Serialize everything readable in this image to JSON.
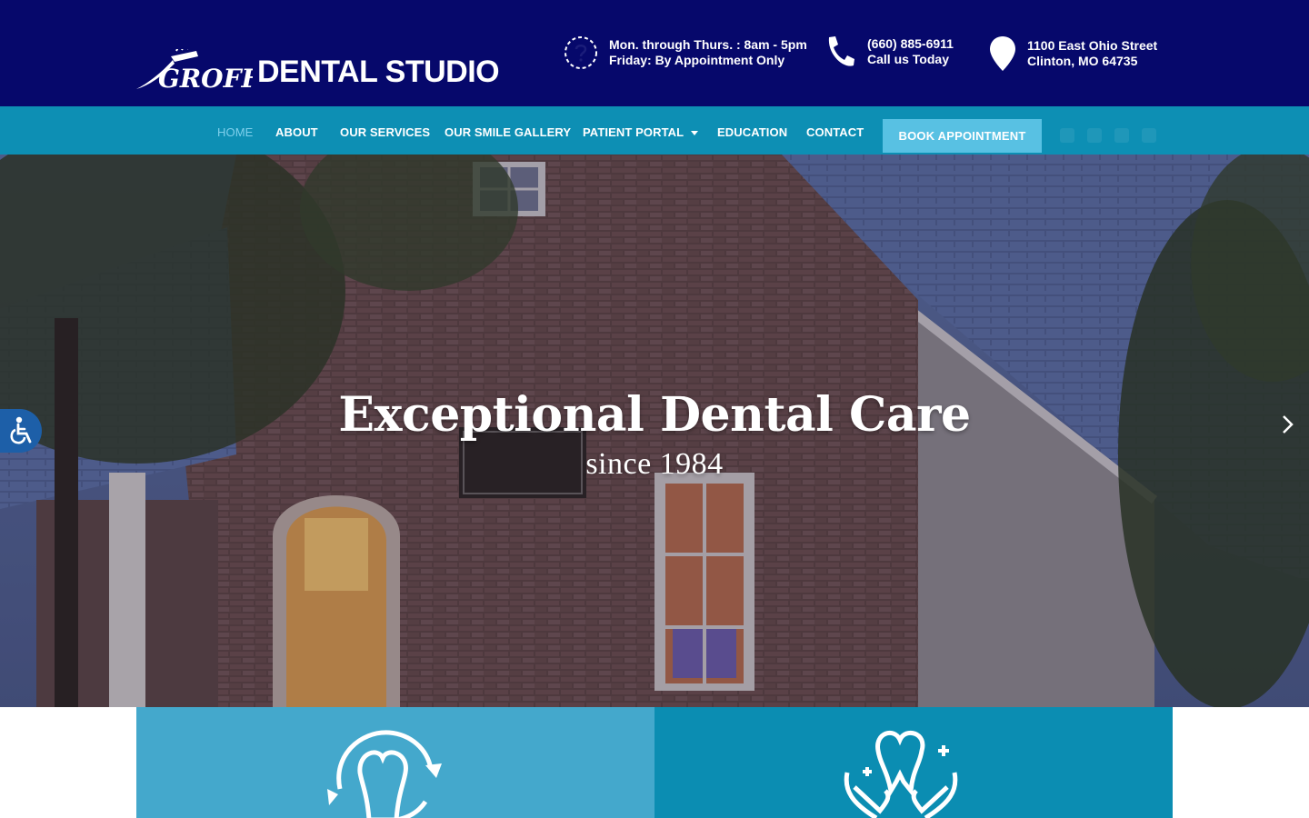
{
  "header": {
    "logo": {
      "script_text": "GROFF",
      "brand_text": "DENTAL STUDIO"
    },
    "hours": {
      "icon": "clock-question-icon",
      "line1": "Mon. through Thurs. : 8am - 5pm",
      "line2": "Friday: By Appointment Only"
    },
    "phone": {
      "icon": "phone-icon",
      "line1": "(660) 885-6911",
      "line2": "Call us Today"
    },
    "address": {
      "icon": "map-pin-icon",
      "line1": "1100 East Ohio Street",
      "line2": "Clinton, MO 64735"
    }
  },
  "nav": {
    "items": [
      {
        "label": "HOME",
        "active": true
      },
      {
        "label": "ABOUT"
      },
      {
        "label": "OUR SERVICES"
      },
      {
        "label": "OUR SMILE GALLERY"
      },
      {
        "label": "PATIENT PORTAL"
      },
      {
        "label": "EDUCATION"
      },
      {
        "label": "CONTACT"
      }
    ],
    "book_label": "BOOK APPOINTMENT"
  },
  "hero": {
    "title": "Exceptional Dental Care",
    "subtitle": "since 1984",
    "next_icon": "chevron-right-icon",
    "accessibility_icon": "wheelchair-icon"
  },
  "cards": [
    {
      "icon": "tooth-refresh-icon",
      "color": "#44a8cc"
    },
    {
      "icon": "hands-tooth-icon",
      "color": "#0b8db2"
    }
  ],
  "colors": {
    "header_bg": "#06086b",
    "nav_bg": "#0d8fb4",
    "nav_active": "#7fd0ec",
    "button_bg": "#58c1e3"
  }
}
